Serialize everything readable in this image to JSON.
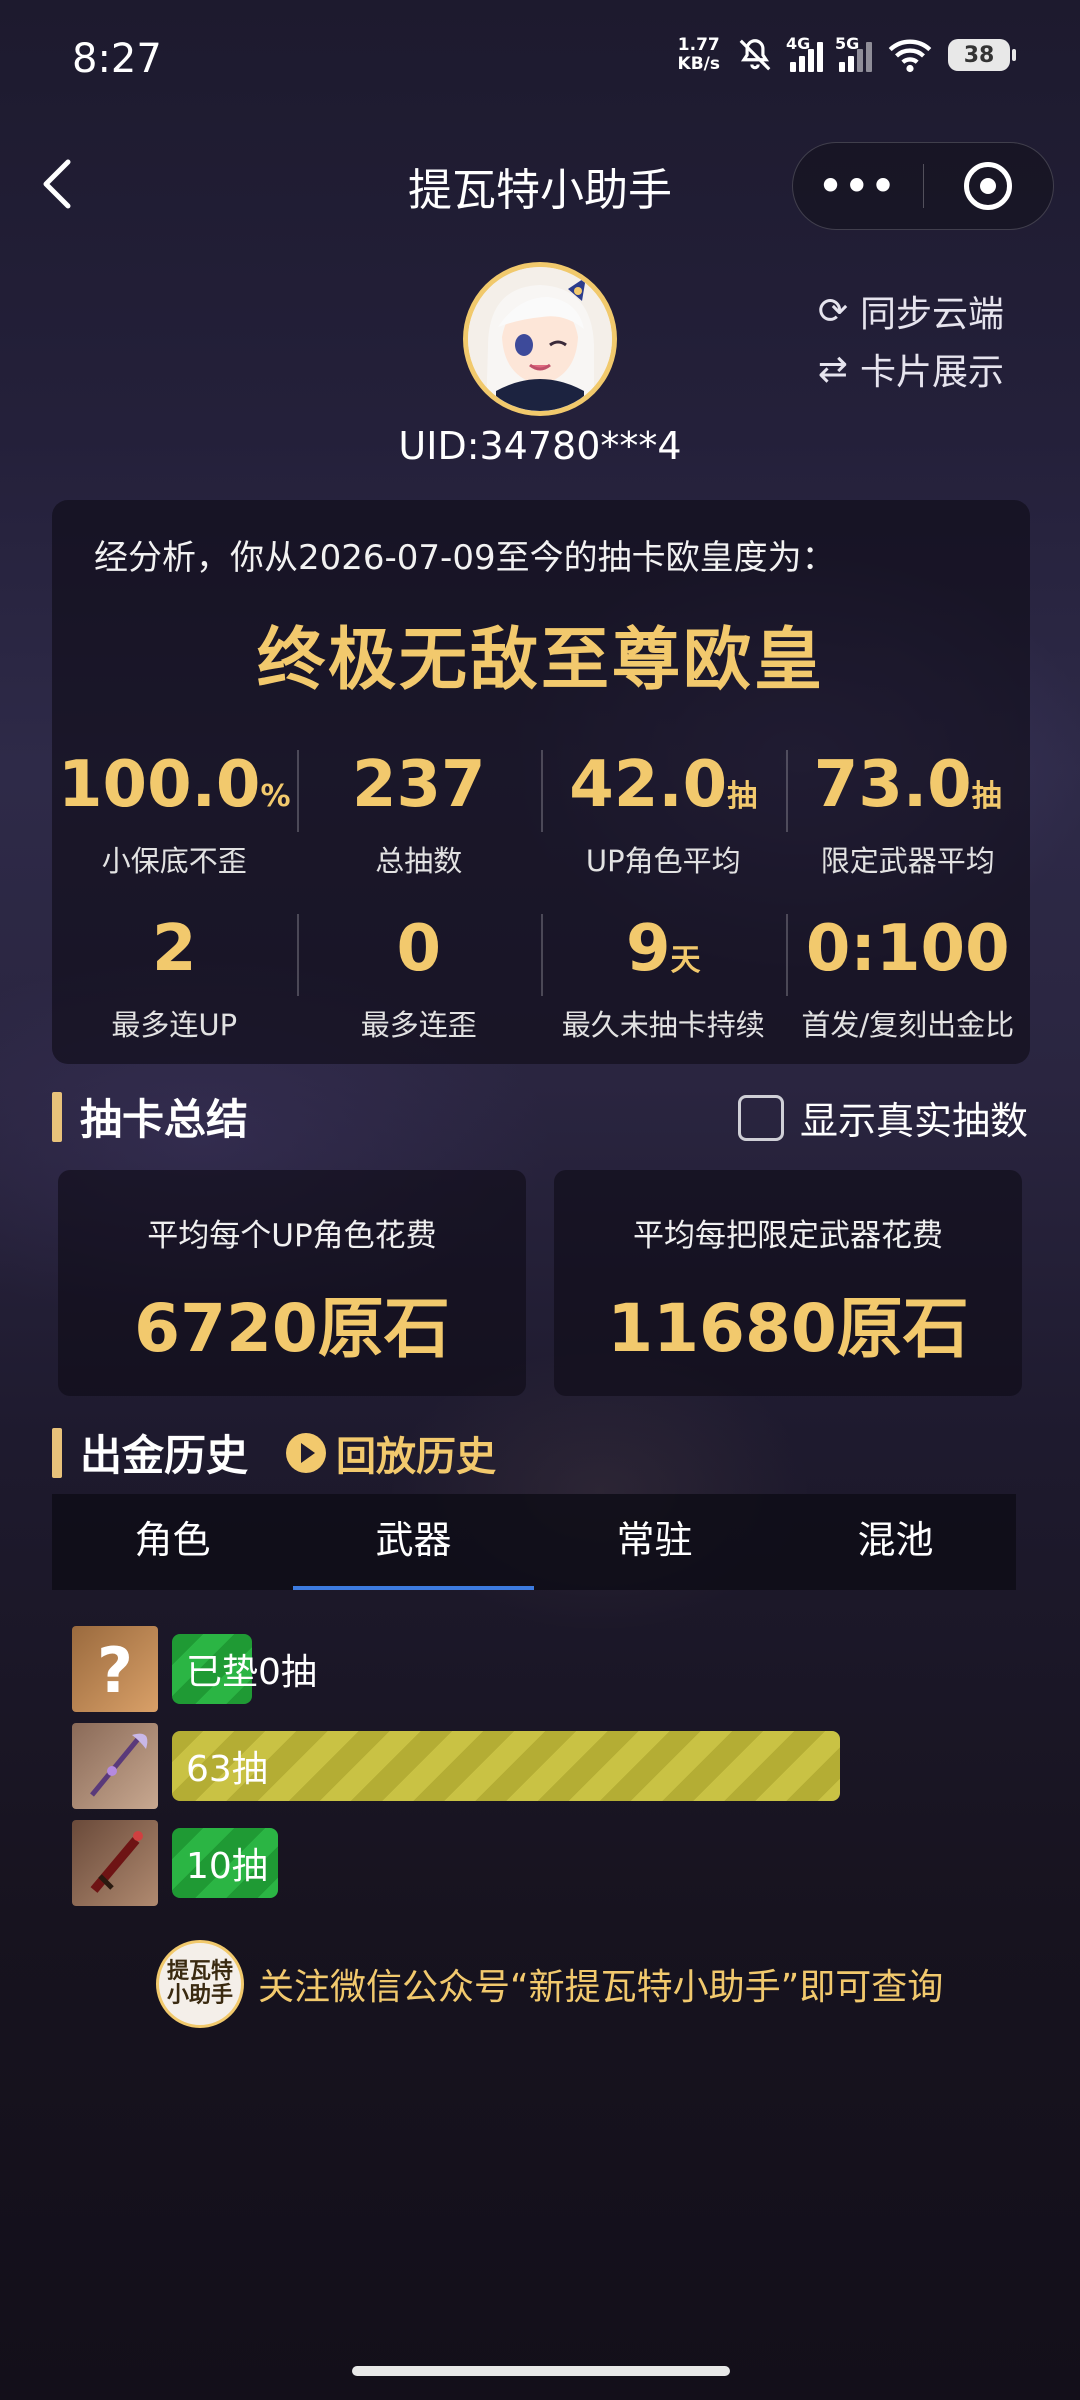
{
  "status_bar": {
    "time": "8:27",
    "net_speed_value": "1.77",
    "net_speed_unit": "KB/s",
    "sig1_label": "4G",
    "sig2_label": "5G",
    "battery": "38"
  },
  "nav": {
    "title": "提瓦特小助手",
    "back_icon": "chevron-left-icon",
    "more_icon": "more-dots-icon",
    "close_icon": "target-icon"
  },
  "profile": {
    "uid": "UID:34780***4",
    "sync_label": "同步云端",
    "card_label": "卡片展示"
  },
  "analysis": {
    "intro": "经分析，你从2026-07-09至今的抽卡欧皇度为：",
    "rank": "终极无敌至尊欧皇",
    "stats_row1": [
      {
        "value": "100.0",
        "unit": "%",
        "label": "小保底不歪"
      },
      {
        "value": "237",
        "unit": "",
        "label": "总抽数"
      },
      {
        "value": "42.0",
        "unit": "抽",
        "label": "UP角色平均"
      },
      {
        "value": "73.0",
        "unit": "抽",
        "label": "限定武器平均"
      }
    ],
    "stats_row2": [
      {
        "value": "2",
        "unit": "",
        "label": "最多连UP"
      },
      {
        "value": "0",
        "unit": "",
        "label": "最多连歪"
      },
      {
        "value": "9",
        "unit": "天",
        "label": "最久未抽卡持续"
      },
      {
        "value": "0:100",
        "unit": "",
        "label": "首发/复刻出金比"
      }
    ]
  },
  "summary": {
    "title": "抽卡总结",
    "toggle_label": "显示真实抽数",
    "toggle_checked": false,
    "cards": [
      {
        "label": "平均每个UP角色花费",
        "value": "6720原石"
      },
      {
        "label": "平均每把限定武器花费",
        "value": "11680原石"
      }
    ]
  },
  "history": {
    "title": "出金历史",
    "replay_label": "回放历史",
    "tabs": [
      "角色",
      "武器",
      "常驻",
      "混池"
    ],
    "active_tab": 1,
    "items": [
      {
        "label": "已垫0抽",
        "pulls": 0,
        "icon": "question-mark-icon",
        "color": "green"
      },
      {
        "label": "63抽",
        "pulls": 63,
        "icon": "polearm-weapon-icon",
        "color": "yellow"
      },
      {
        "label": "10抽",
        "pulls": 10,
        "icon": "claymore-weapon-icon",
        "color": "green"
      }
    ]
  },
  "footer": {
    "logo_text": "提瓦特小助手",
    "note": "关注微信公众号“新提瓦特小助手”即可查询"
  },
  "colors": {
    "gold": "#f2c96d",
    "tab_active": "#3d7be0",
    "bar_green": "#2bb544",
    "bar_yellow": "#c9c244"
  }
}
